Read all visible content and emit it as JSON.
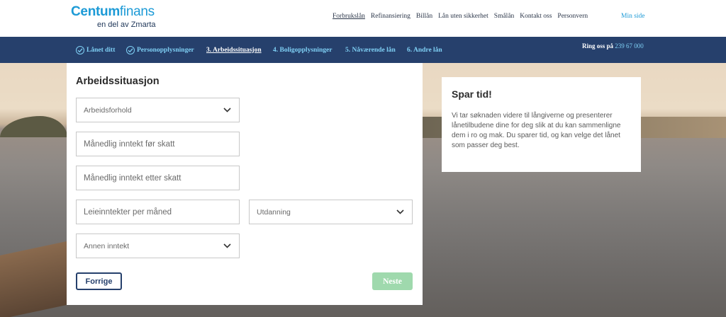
{
  "brand": {
    "name_bold": "Centum",
    "name_light": "finans",
    "tagline": "en del av Zmarta"
  },
  "topnav": {
    "items": [
      {
        "label": "Forbrukslån",
        "active": true
      },
      {
        "label": "Refinansiering",
        "active": false
      },
      {
        "label": "Billån",
        "active": false
      },
      {
        "label": "Lån uten sikkerhet",
        "active": false
      },
      {
        "label": "Smålån",
        "active": false
      },
      {
        "label": "Kontakt oss",
        "active": false
      },
      {
        "label": "Personvern",
        "active": false
      }
    ],
    "my_page": "Min side"
  },
  "steps": {
    "items": [
      {
        "label": "Lånet ditt",
        "done": true
      },
      {
        "label": "Personopplysninger",
        "done": true
      },
      {
        "label": "3. Arbeidssituasjon",
        "active": true
      },
      {
        "label": "4. Boligopplysninger"
      },
      {
        "label": "5. Nåværende lån"
      },
      {
        "label": "6. Andre lån"
      }
    ],
    "phone_label": "Ring oss på",
    "phone_number": "239 67 000"
  },
  "form": {
    "title": "Arbeidssituasjon",
    "employment": {
      "placeholder": "Arbeidsforhold"
    },
    "income_before_tax": {
      "placeholder": "Månedlig inntekt før skatt"
    },
    "income_after_tax": {
      "placeholder": "Månedlig inntekt etter skatt"
    },
    "rental_income": {
      "placeholder": "Leieinntekter per måned"
    },
    "education": {
      "placeholder": "Utdanning"
    },
    "other_income": {
      "placeholder": "Annen inntekt"
    },
    "prev_label": "Forrige",
    "next_label": "Neste"
  },
  "info": {
    "title": "Spar tid!",
    "text": "Vi tar søknaden videre til långiverne og presenterer lånetilbudene dine for deg slik at du kan sammenligne dem i ro og mak. Du sparer tid, og kan velge det lånet som passer deg best."
  },
  "colors": {
    "brand": "#1c9ad6",
    "navy": "#26406c",
    "step_link": "#7fd0f5",
    "next_button": "#9fd9ad"
  }
}
